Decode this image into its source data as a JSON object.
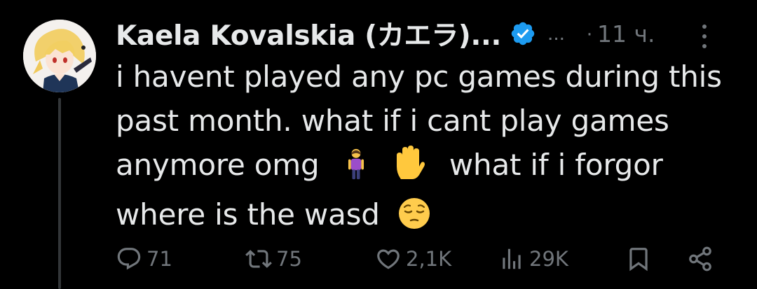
{
  "tweet": {
    "author_name": "Kaela Kovalskia (カエラ)...",
    "handle_ellipsis": "...",
    "separator": "·",
    "time": "11 ч.",
    "text_lines": [
      "i havent played any pc games during this",
      "past month. what if i cant play games",
      "anymore omg",
      "what if i forgor",
      "where is the wasd"
    ],
    "emojis": [
      "woman-standing-emoji",
      "raised-hand-emoji",
      "pensive-face-emoji"
    ]
  },
  "actions": {
    "replies": "71",
    "retweets": "75",
    "likes": "2,1K",
    "views": "29K"
  },
  "colors": {
    "background": "#000000",
    "text": "#e7e9ea",
    "muted": "#71767b",
    "verified": "#1d9bf0"
  }
}
